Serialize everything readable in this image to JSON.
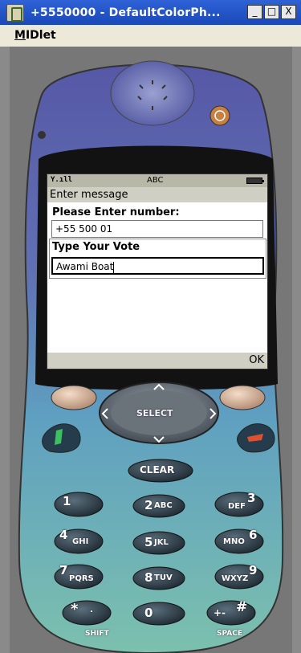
{
  "window": {
    "title": "+5550000 - DefaultColorPh...",
    "minimize": "_",
    "maximize": "□",
    "close": "X"
  },
  "menu": {
    "items": [
      {
        "first": "M",
        "rest": "IDlet"
      }
    ]
  },
  "phone_screen": {
    "signal": "Y.ıll",
    "input_mode": "ABC",
    "header": "Enter message",
    "number_label": "Please Enter number:",
    "number_value": "+55 500 01",
    "vote_label": "Type Your Vote",
    "vote_value": "Awami Boat",
    "softkey_right": "OK"
  },
  "keypad": {
    "select": "SELECT",
    "clear": "CLEAR",
    "keys": [
      {
        "num": "1",
        "letters": ""
      },
      {
        "num": "2",
        "letters": "ABC"
      },
      {
        "num": "3",
        "letters": "DEF"
      },
      {
        "num": "4",
        "letters": "GHI"
      },
      {
        "num": "5",
        "letters": "JKL"
      },
      {
        "num": "6",
        "letters": "MNO"
      },
      {
        "num": "7",
        "letters": "PQRS"
      },
      {
        "num": "8",
        "letters": "TUV"
      },
      {
        "num": "9",
        "letters": "WXYZ"
      },
      {
        "num": "*",
        "letters": "."
      },
      {
        "num": "0",
        "letters": ""
      },
      {
        "num": "#",
        "letters": "+-"
      }
    ],
    "shift": "SHIFT",
    "space": "SPACE"
  },
  "colors": {
    "titlebar": "#1a48b8",
    "menubar": "#ece9d8",
    "phone_top": "#5a5ea8",
    "phone_bottom": "#6fb0b0",
    "screen_bg": "#ffffff"
  }
}
